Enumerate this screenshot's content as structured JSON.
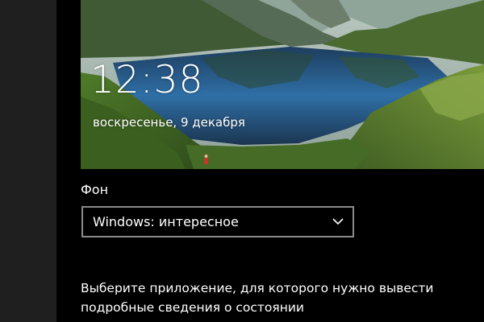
{
  "lockscreen_preview": {
    "time": "12:38",
    "date": "воскресенье, 9 декабря"
  },
  "background_setting": {
    "label": "Фон",
    "selected_value": "Windows: интересное"
  },
  "detailed_status_prompt": {
    "line1": "Выберите приложение, для которого нужно вывести",
    "line2": "подробные сведения о состоянии"
  },
  "colors": {
    "page_background": "#000000",
    "nav_strip": "#1f1f1f",
    "dropdown_border": "#8a8a8a",
    "text": "#ffffff"
  },
  "icons": {
    "dropdown_chevron": "chevron-down-icon"
  }
}
